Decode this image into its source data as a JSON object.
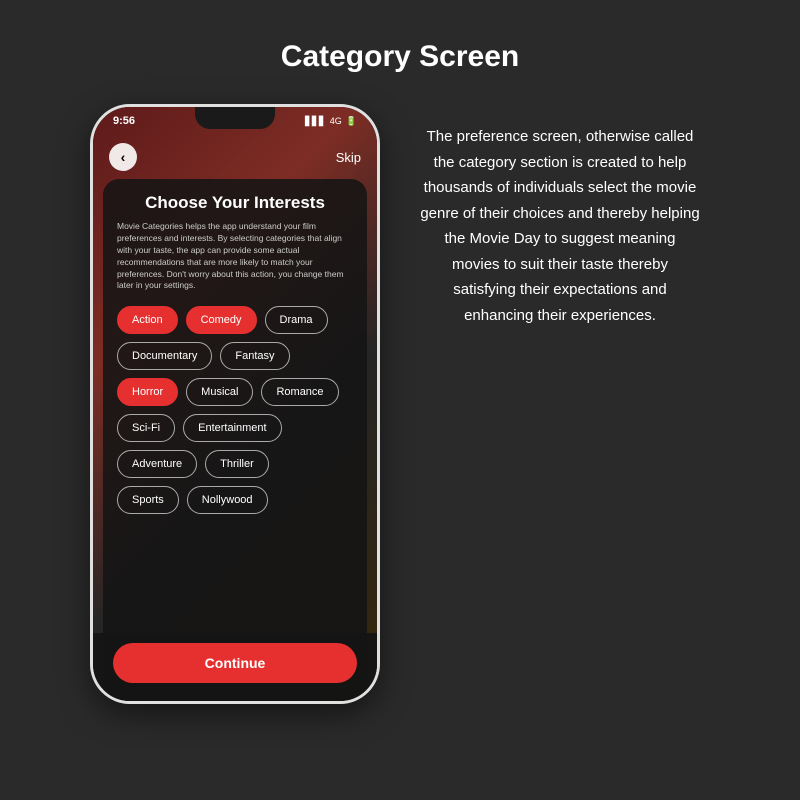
{
  "page": {
    "title": "Category Screen",
    "description": "The preference screen, otherwise called the category section is created to help thousands of individuals select the movie genre of their choices and thereby helping the Movie Day to suggest meaning movies to suit their taste thereby satisfying their expectations and enhancing their experiences."
  },
  "status_bar": {
    "time": "9:56",
    "signal": "▋▋▋",
    "network": "4G",
    "battery": "🔋"
  },
  "nav": {
    "back_label": "‹",
    "skip_label": "Skip"
  },
  "screen": {
    "title": "Choose Your Interests",
    "description": "Movie Categories helps the app understand your film preferences and interests. By selecting categories that align with your taste, the app can provide some actual recommendations that are more likely to match your preferences. Don't worry about this action, you change them later in your settings."
  },
  "genres": [
    {
      "label": "Action",
      "selected": true
    },
    {
      "label": "Comedy",
      "selected": true
    },
    {
      "label": "Drama",
      "selected": false
    },
    {
      "label": "Documentary",
      "selected": false
    },
    {
      "label": "Fantasy",
      "selected": false
    },
    {
      "label": "Horror",
      "selected": true
    },
    {
      "label": "Musical",
      "selected": false
    },
    {
      "label": "Romance",
      "selected": false
    },
    {
      "label": "Sci-Fi",
      "selected": false
    },
    {
      "label": "Entertainment",
      "selected": false
    },
    {
      "label": "Adventure",
      "selected": false
    },
    {
      "label": "Thriller",
      "selected": false
    },
    {
      "label": "Sports",
      "selected": false
    },
    {
      "label": "Nollywood",
      "selected": false
    }
  ],
  "continue_button": {
    "label": "Continue"
  }
}
